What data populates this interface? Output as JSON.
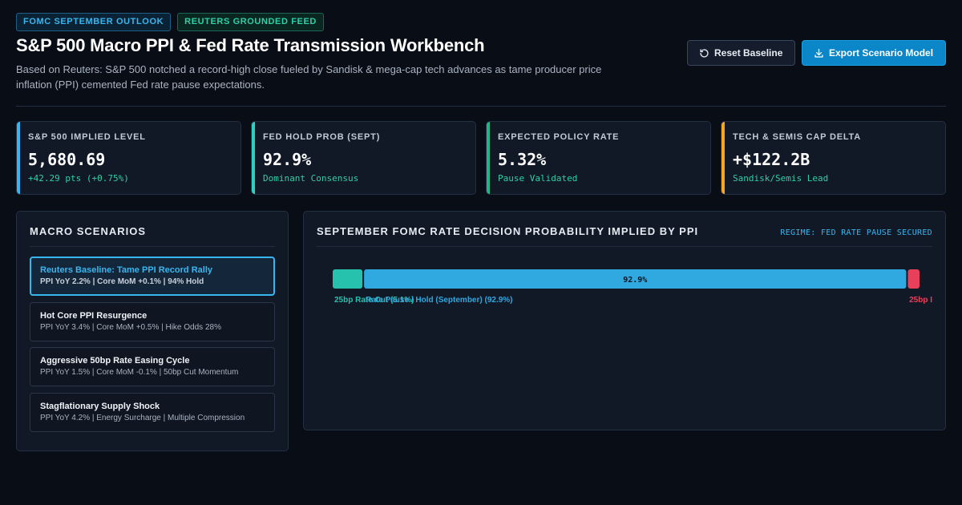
{
  "header": {
    "tags": [
      "FOMC SEPTEMBER OUTLOOK",
      "REUTERS GROUNDED FEED"
    ],
    "title": "S&P 500 Macro PPI & Fed Rate Transmission Workbench",
    "subtitle": "Based on Reuters: S&P 500 notched a record-high close fueled by Sandisk & mega-cap tech advances as tame producer price inflation (PPI) cemented Fed rate pause expectations.",
    "reset_label": "Reset Baseline",
    "export_label": "Export Scenario Model"
  },
  "kpis": [
    {
      "label": "S&P 500 IMPLIED LEVEL",
      "value": "5,680.69",
      "delta": "+42.29 pts (+0.75%)",
      "accent": "#38b6f0"
    },
    {
      "label": "FED HOLD PROB (SEPT)",
      "value": "92.9%",
      "delta": "Dominant Consensus",
      "accent": "#2fd0c0"
    },
    {
      "label": "EXPECTED POLICY RATE",
      "value": "5.32%",
      "delta": "Pause Validated",
      "accent": "#22b585"
    },
    {
      "label": "TECH & SEMIS CAP DELTA",
      "value": "+$122.2B",
      "delta": "Sandisk/Semis Lead",
      "accent": "#f5a623"
    }
  ],
  "scenarios_panel": {
    "title": "MACRO SCENARIOS",
    "items": [
      {
        "name": "Reuters Baseline: Tame PPI Record Rally",
        "desc": "PPI YoY 2.2% | Core MoM +0.1% | 94% Hold",
        "active": true
      },
      {
        "name": "Hot Core PPI Resurgence",
        "desc": "PPI YoY 3.4% | Core MoM +0.5% | Hike Odds 28%",
        "active": false
      },
      {
        "name": "Aggressive 50bp Rate Easing Cycle",
        "desc": "PPI YoY 1.5% | Core MoM -0.1% | 50bp Cut Momentum",
        "active": false
      },
      {
        "name": "Stagflationary Supply Shock",
        "desc": "PPI YoY 4.2% | Energy Surcharge | Multiple Compression",
        "active": false
      }
    ]
  },
  "probability_panel": {
    "title": "SEPTEMBER FOMC RATE DECISION PROBABILITY IMPLIED BY PPI",
    "regime": "REGIME: FED RATE PAUSE SECURED",
    "segments": [
      {
        "label": "25bp Rate Cut (5.1%)",
        "value": 5.1,
        "color": "#26c2ae",
        "inner": ""
      },
      {
        "label": "Rate Pause / Hold (September) (92.9%)",
        "value": 92.9,
        "color": "#30a8e0",
        "inner": "92.9%"
      },
      {
        "label": "25bp I",
        "value": 2.0,
        "color": "#e8405a",
        "inner": ""
      }
    ]
  },
  "colors": {
    "accent": "#38b6f0",
    "export": "#0b86c9",
    "positive": "#2fd0a8",
    "negative": "#e8405a"
  }
}
